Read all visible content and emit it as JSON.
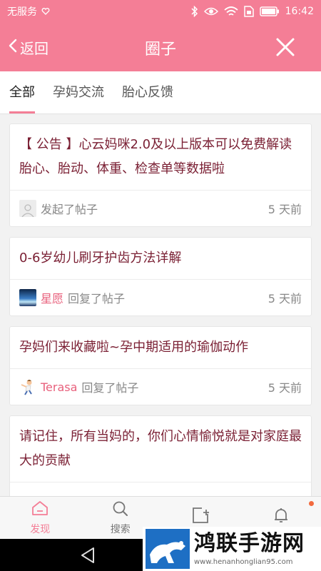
{
  "status_bar": {
    "carrier": "无服务",
    "time": "16:42"
  },
  "header": {
    "back_label": "返回",
    "title": "圈子"
  },
  "tabs": [
    {
      "label": "全部",
      "active": true
    },
    {
      "label": "孕妈交流",
      "active": false
    },
    {
      "label": "胎心反馈",
      "active": false
    }
  ],
  "posts": [
    {
      "title": "【 公告 】心云妈咪2.0及以上版本可以免费解读胎心、胎动、体重、检查单等数据啦",
      "user": "",
      "action": "发起了帖子",
      "time": "5 天前",
      "avatar": "default-avatar"
    },
    {
      "title": "0-6岁幼儿刷牙护齿方法详解",
      "user": "星愿",
      "action": "回复了帖子",
      "time": "5 天前",
      "avatar": "night-sky-avatar"
    },
    {
      "title": "孕妈们来收藏啦~孕中期适用的瑜伽动作",
      "user": "Terasa",
      "action": "回复了帖子",
      "time": "5 天前",
      "avatar": "cartoon-figure-avatar"
    },
    {
      "title": "请记住，所有当妈的，你们心情愉悦就是对家庭最大的贡献",
      "user": "",
      "action": "",
      "time": "",
      "avatar": ""
    }
  ],
  "bottom_nav": [
    {
      "label": "发现",
      "icon": "home-icon",
      "active": true
    },
    {
      "label": "搜索",
      "icon": "search-icon",
      "active": false
    },
    {
      "label": "",
      "icon": "new-post-icon",
      "active": false
    },
    {
      "label": "",
      "icon": "bell-icon",
      "active": false,
      "badge": true
    }
  ],
  "watermark": {
    "title": "鸿联手游网",
    "url": "www.henanhonglian95.com"
  },
  "colors": {
    "brand": "#f47e96",
    "post_title": "#7a1f33",
    "username": "#e8607c",
    "badge": "#f26a3e"
  }
}
